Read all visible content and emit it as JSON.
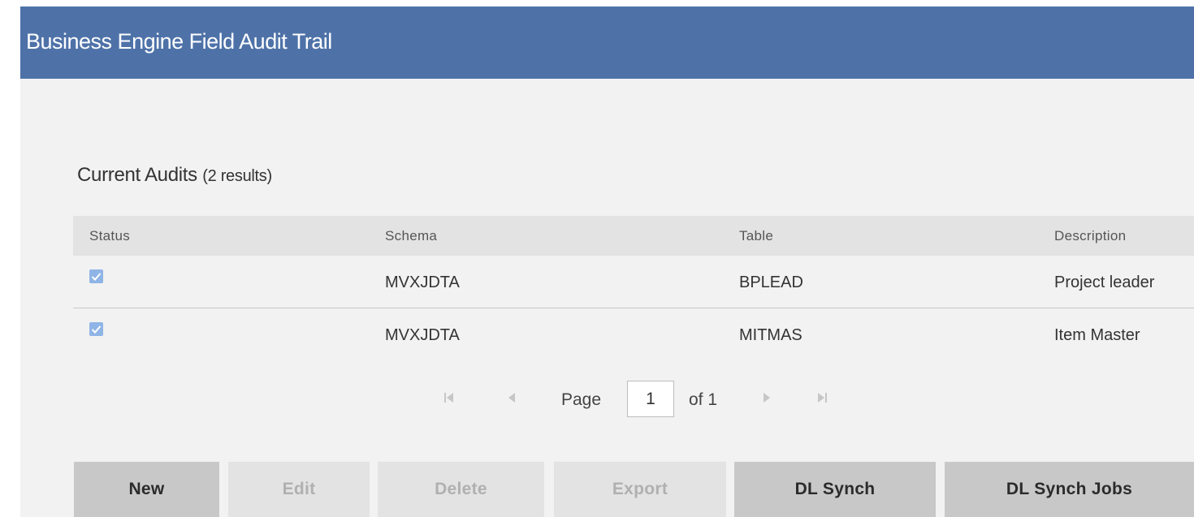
{
  "header": {
    "title": "Business Engine Field Audit Trail",
    "background_color": "#4e72a8"
  },
  "section": {
    "heading": "Current Audits",
    "count_text": "(2 results)"
  },
  "table": {
    "columns": [
      "Status",
      "Schema",
      "Table",
      "Description"
    ],
    "rows": [
      {
        "status_checked": true,
        "schema": "MVXJDTA",
        "table": "BPLEAD",
        "description": "Project leader"
      },
      {
        "status_checked": true,
        "schema": "MVXJDTA",
        "table": "MITMAS",
        "description": "Item Master"
      }
    ]
  },
  "pagination": {
    "first_icon": "first-page-icon",
    "prev_icon": "previous-page-icon",
    "next_icon": "next-page-icon",
    "last_icon": "last-page-icon",
    "page_label": "Page",
    "current_page": "1",
    "of_label": "of 1"
  },
  "buttons": {
    "new": "New",
    "edit": "Edit",
    "delete": "Delete",
    "export": "Export",
    "dl_synch": "DL Synch",
    "dl_synch_jobs": "DL Synch Jobs"
  }
}
